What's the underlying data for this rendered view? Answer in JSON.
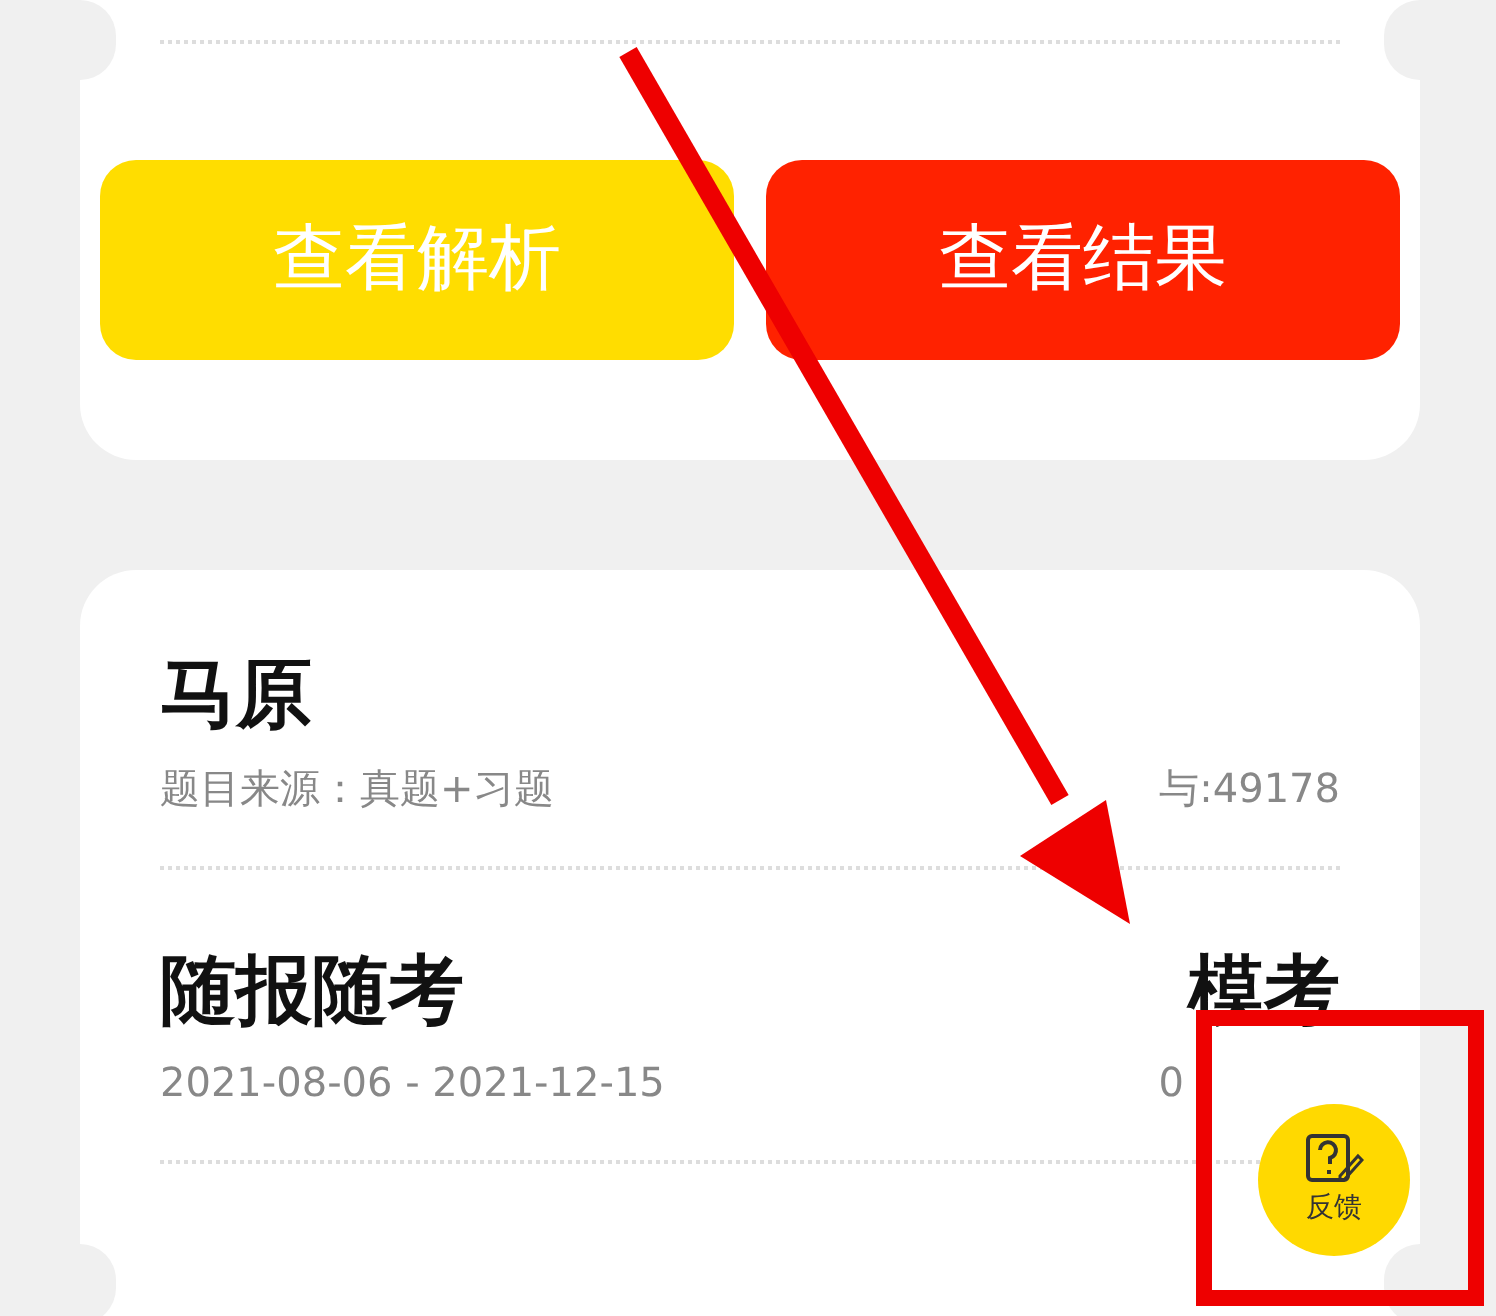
{
  "result_card": {
    "buttons": [
      {
        "label": "查看解析",
        "kind": "analysis"
      },
      {
        "label": "查看结果",
        "kind": "result"
      }
    ]
  },
  "exam_list": [
    {
      "title": "马原",
      "subtitle": "题目来源：真题+习题",
      "meta": "与:49178"
    },
    {
      "title": "随报随考",
      "subtitle": "2021-08-06 - 2021-12-15",
      "right_title": "模考",
      "meta": "0"
    }
  ],
  "feedback_button": {
    "label": "反馈"
  }
}
